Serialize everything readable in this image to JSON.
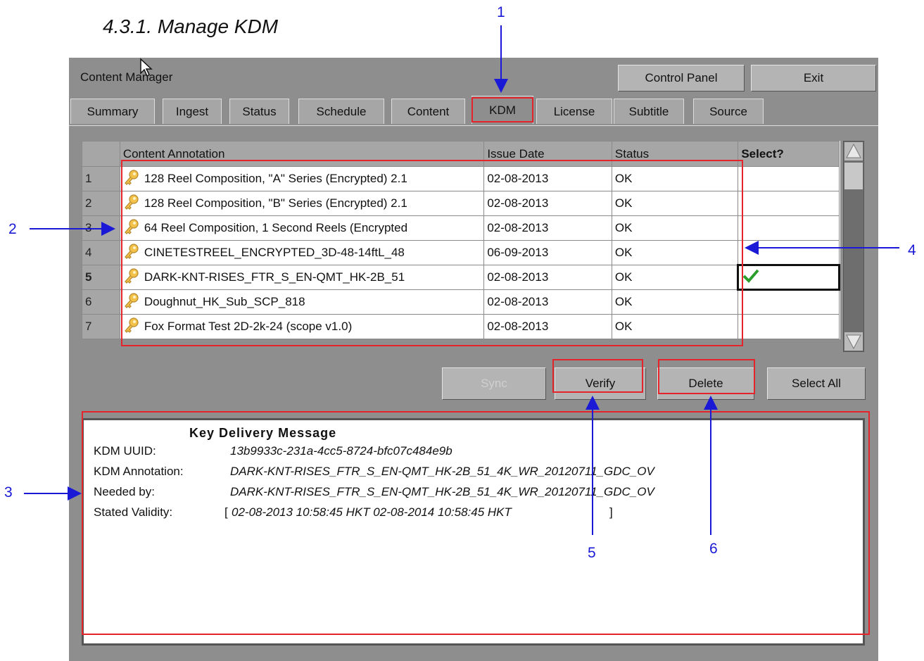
{
  "heading": "4.3.1. Manage KDM",
  "app": {
    "title": "Content Manager",
    "buttons": {
      "control_panel": "Control Panel",
      "exit": "Exit"
    }
  },
  "tabs": [
    "Summary",
    "Ingest",
    "Status",
    "Schedule",
    "Content",
    "KDM",
    "License",
    "Subtitle",
    "Source"
  ],
  "active_tab": "KDM",
  "table": {
    "headers": [
      "",
      "Content Annotation",
      "Issue Date",
      "Status",
      "Select?"
    ],
    "rows": [
      {
        "num": "1",
        "annotation": "128 Reel Composition, \"A\" Series (Encrypted) 2.1",
        "date": "02-08-2013",
        "status": "OK",
        "selected": false
      },
      {
        "num": "2",
        "annotation": "128 Reel Composition, \"B\" Series (Encrypted) 2.1",
        "date": "02-08-2013",
        "status": "OK",
        "selected": false
      },
      {
        "num": "3",
        "annotation": "64 Reel Composition, 1 Second Reels (Encrypted",
        "date": "02-08-2013",
        "status": "OK",
        "selected": false
      },
      {
        "num": "4",
        "annotation": "CINETESTREEL_ENCRYPTED_3D-48-14ftL_48",
        "date": "06-09-2013",
        "status": "OK",
        "selected": false
      },
      {
        "num": "5",
        "annotation": "DARK-KNT-RISES_FTR_S_EN-QMT_HK-2B_51",
        "date": "02-08-2013",
        "status": "OK",
        "selected": true
      },
      {
        "num": "6",
        "annotation": "Doughnut_HK_Sub_SCP_818",
        "date": "02-08-2013",
        "status": "OK",
        "selected": false
      },
      {
        "num": "7",
        "annotation": "Fox Format Test 2D-2k-24 (scope v1.0)",
        "date": "02-08-2013",
        "status": "OK",
        "selected": false
      }
    ]
  },
  "actions": {
    "sync": "Sync",
    "verify": "Verify",
    "delete": "Delete",
    "select_all": "Select All"
  },
  "kdm_panel": {
    "title": "Key Delivery Message",
    "uuid_label": "KDM UUID:",
    "uuid": "13b9933c-231a-4cc5-8724-bfc07c484e9b",
    "annotation_label": "KDM Annotation:",
    "annotation": "DARK-KNT-RISES_FTR_S_EN-QMT_HK-2B_51_4K_WR_20120711_GDC_OV",
    "needed_label": "Needed by:",
    "needed": "DARK-KNT-RISES_FTR_S_EN-QMT_HK-2B_51_4K_WR_20120711_GDC_OV",
    "validity_label": "Stated Validity:",
    "validity_open": "[",
    "validity": "02-08-2013 10:58:45 HKT   02-08-2014 10:58:45 HKT",
    "validity_close": "]"
  },
  "callouts": [
    "1",
    "2",
    "3",
    "4",
    "5",
    "6"
  ],
  "colors": {
    "callout": "#1a1ad6",
    "highlight": "#e3242b",
    "check": "#2a9d2a"
  }
}
